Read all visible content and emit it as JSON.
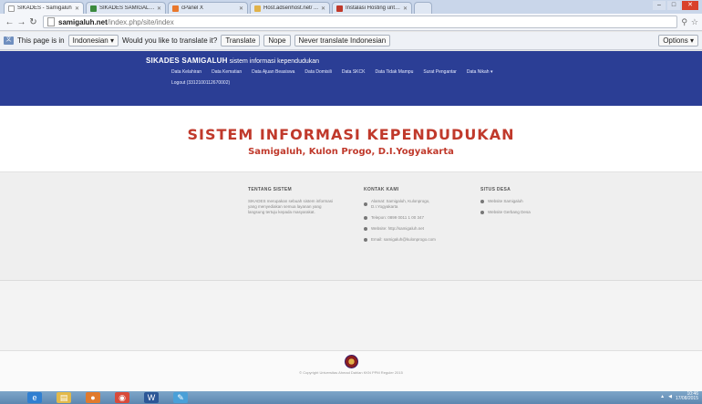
{
  "browser": {
    "tabs": [
      {
        "label": "SIKADES - Samigaluh",
        "active": true,
        "color": "#ffffff"
      },
      {
        "label": "SIKADES SAMIGALUH",
        "active": false,
        "color": "#3b8a3e"
      },
      {
        "label": "cPanel X",
        "active": false,
        "color": "#e9782d"
      },
      {
        "label": "Host.adsenhost.net/ ...",
        "active": false,
        "color": "#e0b24a"
      },
      {
        "label": "Instalasi Hosting untuk di...",
        "active": false,
        "color": "#c0392b"
      }
    ],
    "url_host": "samigaluh.net",
    "url_path": "/index.php/site/index"
  },
  "translate_bar": {
    "prefix": "This page is in",
    "language": "Indonesian ▾",
    "question": "Would you like to translate it?",
    "translate_label": "Translate",
    "nope_label": "Nope",
    "never_label": "Never translate Indonesian",
    "options_label": "Options ▾"
  },
  "site": {
    "brand_name": "SIKADES SAMIGALUH",
    "brand_tagline": "sistem informasi kependudukan",
    "menu": [
      "Data Kelahiran",
      "Data Kematian",
      "Data Ajuan Beasiswa",
      "Data Domisili",
      "Data SKCK",
      "Data Tidak Mampu",
      "Surat Pengantar",
      "Data Nikah ▾"
    ],
    "logout": "Logout (3312100112670002)",
    "title": "SISTEM INFORMASI KEPENDUDUKAN",
    "subtitle": "Samigaluh, Kulon Progo, D.I.Yogyakarta"
  },
  "info": {
    "about_heading": "TENTANG SISTEM",
    "about_text": "SIKADES merupakan sebuah sistem informasi yang menyediakan semua layanan yang langsung tertuju kepada masyarakat.",
    "contact_heading": "KONTAK KAMI",
    "contact": [
      "Alamat: Samigaluh, Kulonprogo, D.I.Yogyakarta",
      "Telepon: 0899 0011 1 00 347",
      "Website: http://samigaluh.net",
      "Email: samigaluh@kulonprogo.com"
    ],
    "sites_heading": "SITUS DESA",
    "sites": [
      "Website Samigaluh",
      "Website Gerbang Desa"
    ]
  },
  "footer": {
    "copyright": "© Copyright Universitas Ahmad Dahlan KKN PPM Reguler 2015"
  },
  "taskbar": {
    "time": "10:46",
    "date": "17/08/2015"
  }
}
